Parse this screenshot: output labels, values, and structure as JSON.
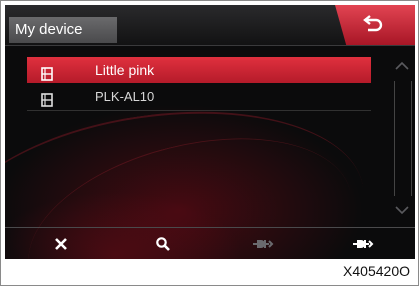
{
  "header": {
    "title": "My device"
  },
  "devices": [
    {
      "label": "Little pink",
      "icon": "phone-icon",
      "selected": true
    },
    {
      "label": "PLK-AL10",
      "icon": "phone-icon",
      "selected": false
    }
  ],
  "toolbar": {
    "items": [
      {
        "name": "delete",
        "icon": "close-icon"
      },
      {
        "name": "search",
        "icon": "search-icon"
      },
      {
        "name": "disconnect",
        "icon": "disconnect-icon"
      },
      {
        "name": "connect",
        "icon": "connect-icon"
      }
    ]
  },
  "figure_ref": "X405420O",
  "colors": {
    "accent": "#d42a38",
    "background": "#0b0b0c",
    "disabled": "#6a6a6e"
  }
}
